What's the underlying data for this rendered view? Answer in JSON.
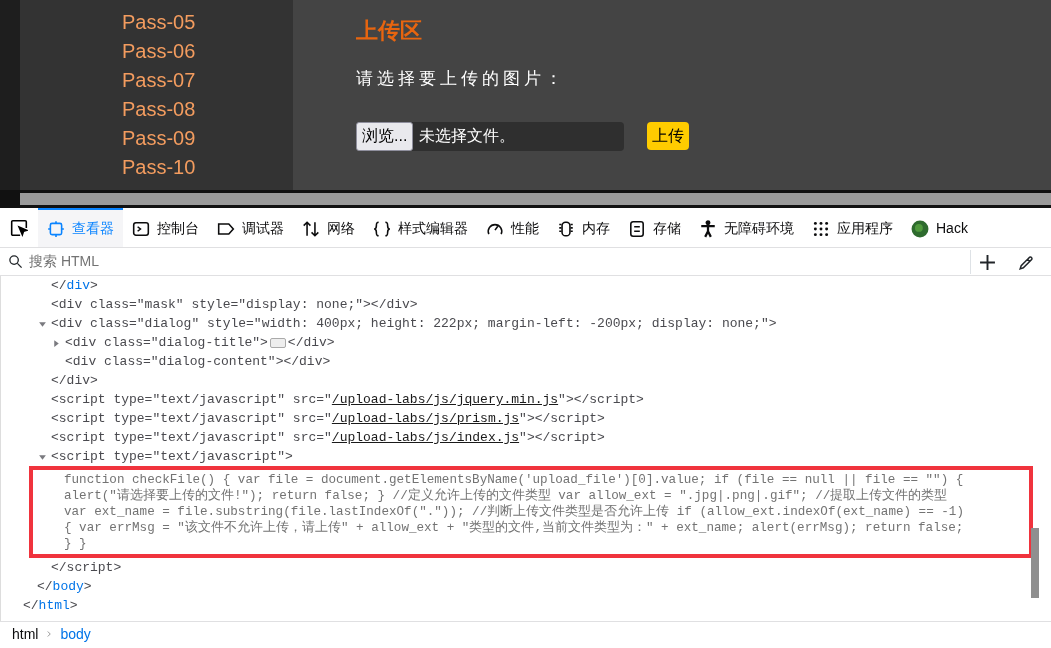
{
  "page": {
    "sidebar": {
      "items": [
        {
          "label": "Pass-05"
        },
        {
          "label": "Pass-06"
        },
        {
          "label": "Pass-07"
        },
        {
          "label": "Pass-08"
        },
        {
          "label": "Pass-09"
        },
        {
          "label": "Pass-10"
        }
      ]
    },
    "upload": {
      "heading": "上传区",
      "prompt": "请选择要上传的图片：",
      "browse_button": "浏览...",
      "file_status": "未选择文件。",
      "upload_button": "上传"
    }
  },
  "devtools": {
    "tabs": [
      {
        "label": "查看器",
        "selected": true
      },
      {
        "label": "控制台",
        "selected": false
      },
      {
        "label": "调试器",
        "selected": false
      },
      {
        "label": "网络",
        "selected": false
      },
      {
        "label": "样式编辑器",
        "selected": false
      },
      {
        "label": "性能",
        "selected": false
      },
      {
        "label": "内存",
        "selected": false
      },
      {
        "label": "存储",
        "selected": false
      },
      {
        "label": "无障碍环境",
        "selected": false
      },
      {
        "label": "应用程序",
        "selected": false
      },
      {
        "label": "Hack",
        "selected": false
      }
    ],
    "inspector": {
      "search": {
        "placeholder": "搜索 HTML"
      },
      "tree": [
        {
          "close": [
            {
              "text": "</"
            },
            {
              "text": "html",
              "selected": true
            },
            {
              "text": ">"
            }
          ],
          "children": [
            {
              "close": [
                {
                  "text": "</"
                },
                {
                  "text": "body",
                  "selected": true
                },
                {
                  "text": ">"
                }
              ],
              "children": [
                {
                  "open": [
                    {
                      "text": "</"
                    },
                    {
                      "text": "div",
                      "selected": true
                    },
                    {
                      "text": ">"
                    }
                  ]
                },
                {
                  "open": [
                    {
                      "text": "<div class=\"mask\" style=\"display: none;\"></div>"
                    }
                  ]
                },
                {
                  "open": [
                    {
                      "text": "<div class=\"dialog\" style=\"width: 400px; height: 222px; margin-left: -200px; display: none;\">"
                    }
                  ],
                  "expanded": true,
                  "close": [
                    {
                      "text": "</div>"
                    }
                  ],
                  "children": [
                    {
                      "open": [
                        {
                          "text": "<div class=\"dialog-title\">"
                        }
                      ],
                      "expanded": false,
                      "after": [
                        {
                          "text": "</div>"
                        }
                      ]
                    },
                    {
                      "open": [
                        {
                          "text": "<div class=\"dialog-content\"></div>"
                        }
                      ]
                    }
                  ]
                },
                {
                  "open": [
                    {
                      "text": "<script type=\"text/javascript\" src=\""
                    },
                    {
                      "text": "/upload-labs/js/jquery.min.js",
                      "link": true
                    },
                    {
                      "text": "\"></script>"
                    }
                  ]
                },
                {
                  "open": [
                    {
                      "text": "<script type=\"text/javascript\" src=\""
                    },
                    {
                      "text": "/upload-labs/js/prism.js",
                      "link": true
                    },
                    {
                      "text": "\"></script>"
                    }
                  ]
                },
                {
                  "open": [
                    {
                      "text": "<script type=\"text/javascript\" src=\""
                    },
                    {
                      "text": "/upload-labs/js/index.js",
                      "link": true
                    },
                    {
                      "text": "\"></script>"
                    }
                  ]
                },
                {
                  "open": [
                    {
                      "text": "<script type=\"text/javascript\">"
                    }
                  ],
                  "expanded": true,
                  "close": [
                    {
                      "text": "</script>"
                    }
                  ],
                  "children": [
                    {
                      "kind": "text",
                      "highlighted": true,
                      "lines": [
                        "function checkFile() { var file = document.getElementsByName('upload_file')[0].value; if (file == null || file == \"\") {",
                        "alert(\"请选择要上传的文件!\"); return false; } //定义允许上传的文件类型 var allow_ext = \".jpg|.png|.gif\"; //提取上传文件的类型",
                        "var ext_name = file.substring(file.lastIndexOf(\".\")); //判断上传文件类型是否允许上传 if (allow_ext.indexOf(ext_name) == -1)",
                        "{ var errMsg = \"该文件不允许上传，请上传\" + allow_ext + \"类型的文件,当前文件类型为：\" + ext_name; alert(errMsg); return false;",
                        "} }"
                      ]
                    }
                  ]
                }
              ]
            }
          ]
        }
      ]
    },
    "breadcrumbs": [
      {
        "label": "html",
        "selected": false
      },
      {
        "label": "body",
        "selected": true
      }
    ]
  }
}
